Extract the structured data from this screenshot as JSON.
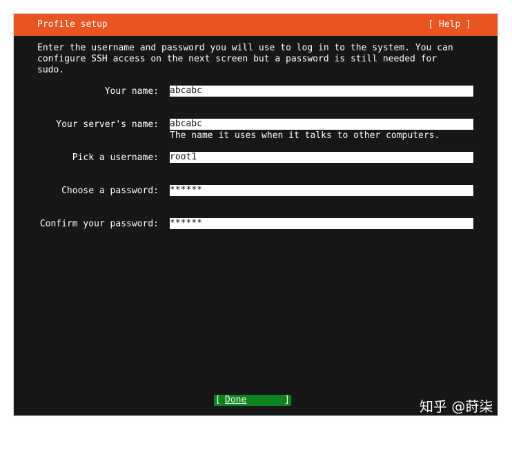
{
  "header": {
    "title": "Profile setup",
    "help_label": "[ Help ]",
    "accent": "#e95420"
  },
  "intro_text": "Enter the username and password you will use to log in to the system. You can\nconfigure SSH access on the next screen but a password is still needed for\nsudo.",
  "form": {
    "your_name": {
      "label": "Your name:",
      "value": "abcabc"
    },
    "server_name": {
      "label": "Your server's name:",
      "value": "abcabc",
      "hint": "The name it uses when it talks to other computers."
    },
    "username": {
      "label": "Pick a username:",
      "value": "root1"
    },
    "password": {
      "label": "Choose a password:",
      "value": "******"
    },
    "confirm_password": {
      "label": "Confirm your password:",
      "value": "******"
    }
  },
  "actions": {
    "done_left": "[",
    "done_label": "Done",
    "done_right": "]",
    "done_color": "#0e8420"
  },
  "watermark": "知乎 @莳柒"
}
